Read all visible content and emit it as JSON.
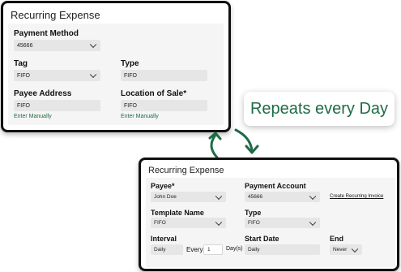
{
  "panel1": {
    "title": "Recurring Expense",
    "payment_method": {
      "label": "Payment Method",
      "value": "45666"
    },
    "tag": {
      "label": "Tag",
      "value": "FIFO"
    },
    "type": {
      "label": "Type",
      "value": "FIFO"
    },
    "payee_address": {
      "label": "Payee Address",
      "value": "FIFO",
      "link": "Enter Manually"
    },
    "location_of_sale": {
      "label": "Location of Sale*",
      "value": "FIFO",
      "link": "Enter Manually"
    }
  },
  "callout": {
    "text": "Repeats every Day"
  },
  "panel2": {
    "title": "Recurring Expense",
    "payee": {
      "label": "Payee*",
      "value": "John Doe"
    },
    "payment_account": {
      "label": "Payment Account",
      "value": "45666",
      "link": "Create Recurring Invoice"
    },
    "template_name": {
      "label": "Template Name",
      "value": "FIFO"
    },
    "type": {
      "label": "Type",
      "value": "FIFO"
    },
    "interval": {
      "label": "Interval",
      "value": "Daily",
      "every_label": "Every",
      "every_value": "1",
      "unit": "Day(s)"
    },
    "start_date": {
      "label": "Start Date",
      "value": "Daily"
    },
    "end": {
      "label": "End",
      "value": "Never"
    }
  },
  "colors": {
    "accent_green": "#1e6b46",
    "border": "#111111",
    "field_bg": "#e6e6e6"
  },
  "icons": [
    "chevron-down-icon",
    "curved-arrow-up-icon",
    "curved-arrow-down-icon"
  ]
}
